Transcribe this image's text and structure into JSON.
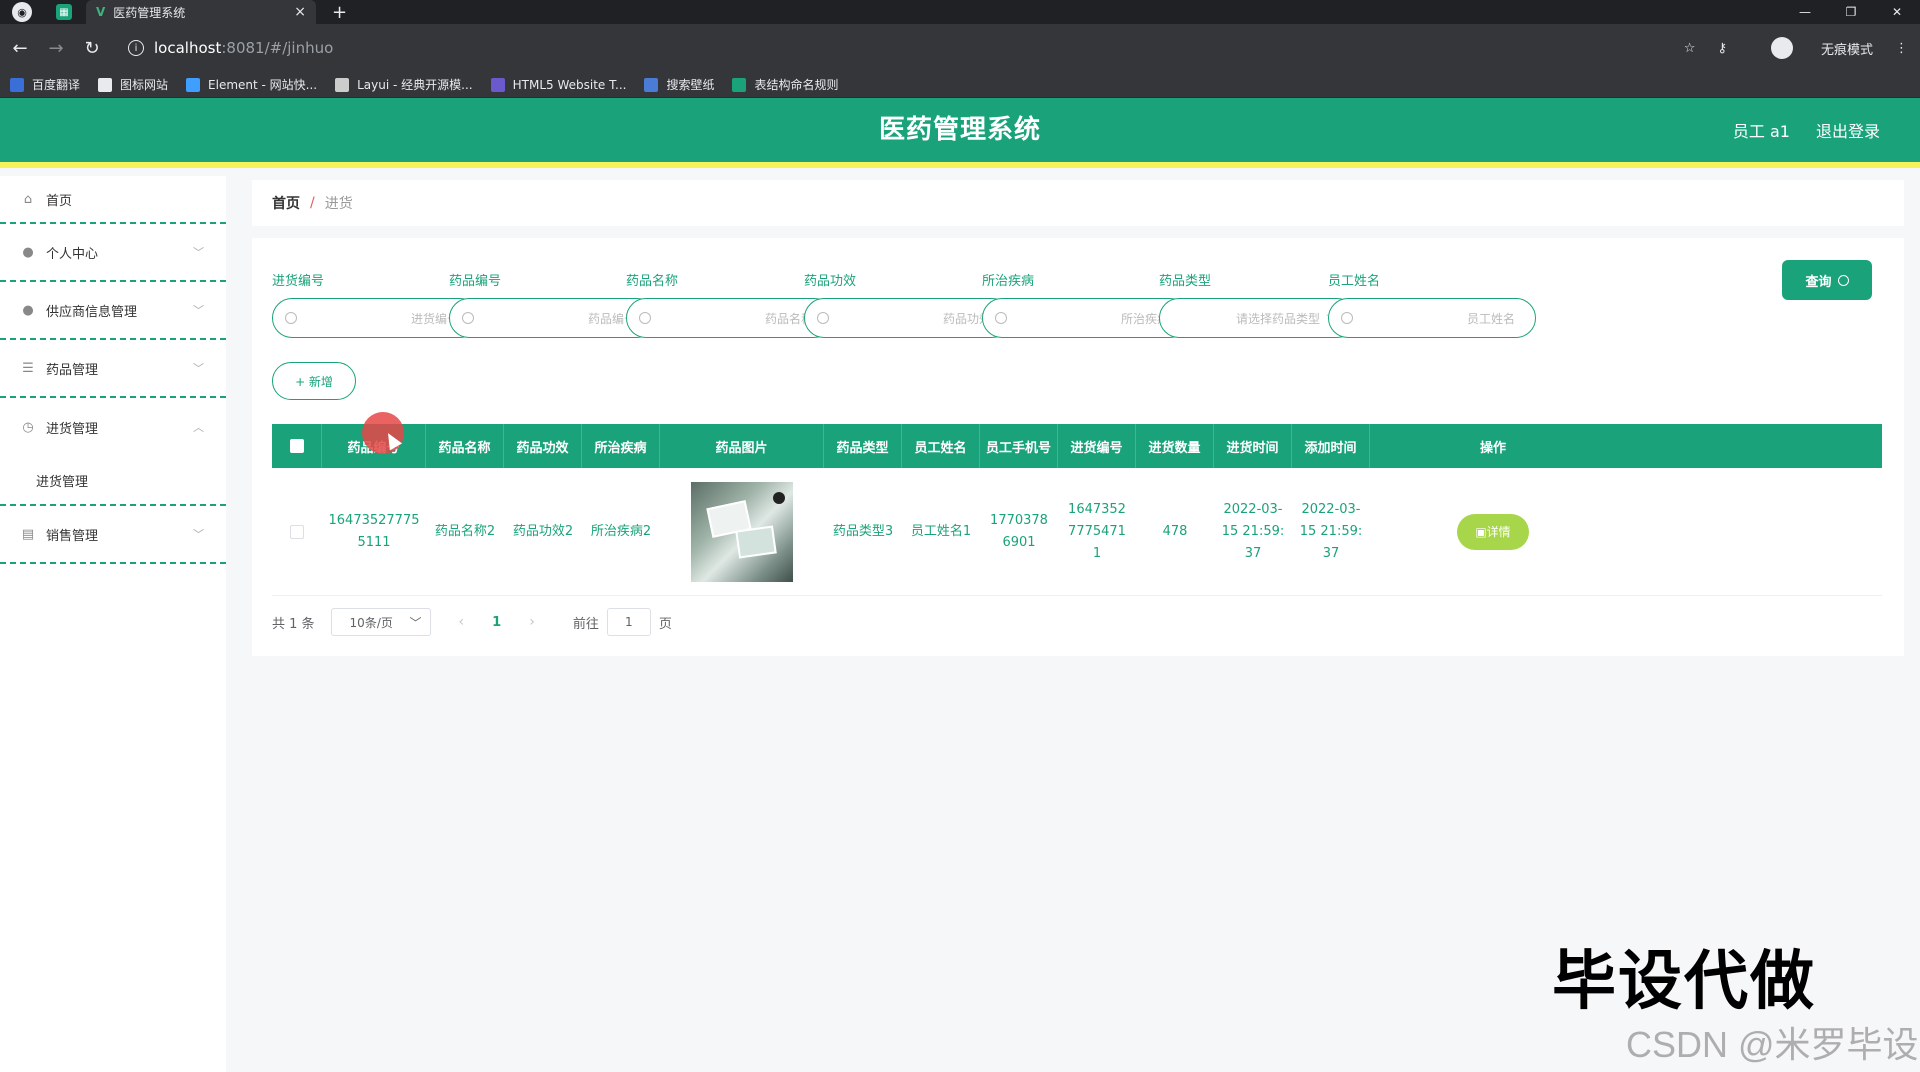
{
  "browser": {
    "tab_title": "医药管理系统",
    "tab_close": "×",
    "new_tab": "+",
    "url_host": "localhost",
    "url_path": ":8081/#/jinhuo",
    "incognito_label": "无痕模式",
    "bookmarks": [
      {
        "label": "百度翻译",
        "color": "#3b6fd8"
      },
      {
        "label": "图标网站",
        "color": "#e8eaed"
      },
      {
        "label": "Element - 网站快...",
        "color": "#409eff"
      },
      {
        "label": "Layui - 经典开源模...",
        "color": "#cccccc"
      },
      {
        "label": "HTML5 Website T...",
        "color": "#6a5acd"
      },
      {
        "label": "搜索壁纸",
        "color": "#4a7cd6"
      },
      {
        "label": "表结构命名规则",
        "color": "#1aa37a"
      }
    ]
  },
  "header": {
    "title": "医药管理系统",
    "user": "员工 a1",
    "logout": "退出登录"
  },
  "sidebar": {
    "items": [
      {
        "label": "首页",
        "icon": "home-icon"
      },
      {
        "label": "个人中心",
        "icon": "user-icon"
      },
      {
        "label": "供应商信息管理",
        "icon": "user-icon"
      },
      {
        "label": "药品管理",
        "icon": "menu-icon"
      },
      {
        "label": "进货管理",
        "icon": "clock-icon"
      },
      {
        "label": "销售管理",
        "icon": "briefcase-icon"
      }
    ],
    "submenu_jinhuo": "进货管理"
  },
  "breadcrumb": {
    "home": "首页",
    "separator": "/",
    "current": "进货"
  },
  "filters": [
    {
      "label": "进货编号",
      "placeholder": "进货编号"
    },
    {
      "label": "药品编号",
      "placeholder": "药品编号"
    },
    {
      "label": "药品名称",
      "placeholder": "药品名称"
    },
    {
      "label": "药品功效",
      "placeholder": "药品功效"
    },
    {
      "label": "所治疾病",
      "placeholder": "所治疾病"
    },
    {
      "label": "药品类型",
      "placeholder": "请选择药品类型"
    },
    {
      "label": "员工姓名",
      "placeholder": "员工姓名"
    }
  ],
  "buttons": {
    "query": "查询",
    "add": "+ 新增",
    "detail": "详情"
  },
  "table": {
    "headers": [
      "药品编号",
      "药品名称",
      "药品功效",
      "所治疾病",
      "药品图片",
      "药品类型",
      "员工姓名",
      "员工手机号",
      "进货编号",
      "进货数量",
      "进货时间",
      "添加时间",
      "操作"
    ],
    "rows": [
      {
        "drug_no": "164735277755111",
        "drug_name": "药品名称2",
        "drug_effect": "药品功效2",
        "disease": "所治疾病2",
        "drug_type": "药品类型3",
        "staff_name": "员工姓名1",
        "staff_phone": "17703786901",
        "purchase_no": "164735277754711",
        "quantity": "478",
        "purchase_time": "2022-03-15 21:59:37",
        "add_time": "2022-03-15 21:59:37"
      }
    ]
  },
  "pagination": {
    "total": "共 1 条",
    "page_size": "10条/页",
    "current": "1",
    "goto": "前往",
    "jump_value": "1",
    "unit": "页"
  },
  "watermark": {
    "main": "毕设代做",
    "sub": "CSDN @米罗毕设"
  }
}
